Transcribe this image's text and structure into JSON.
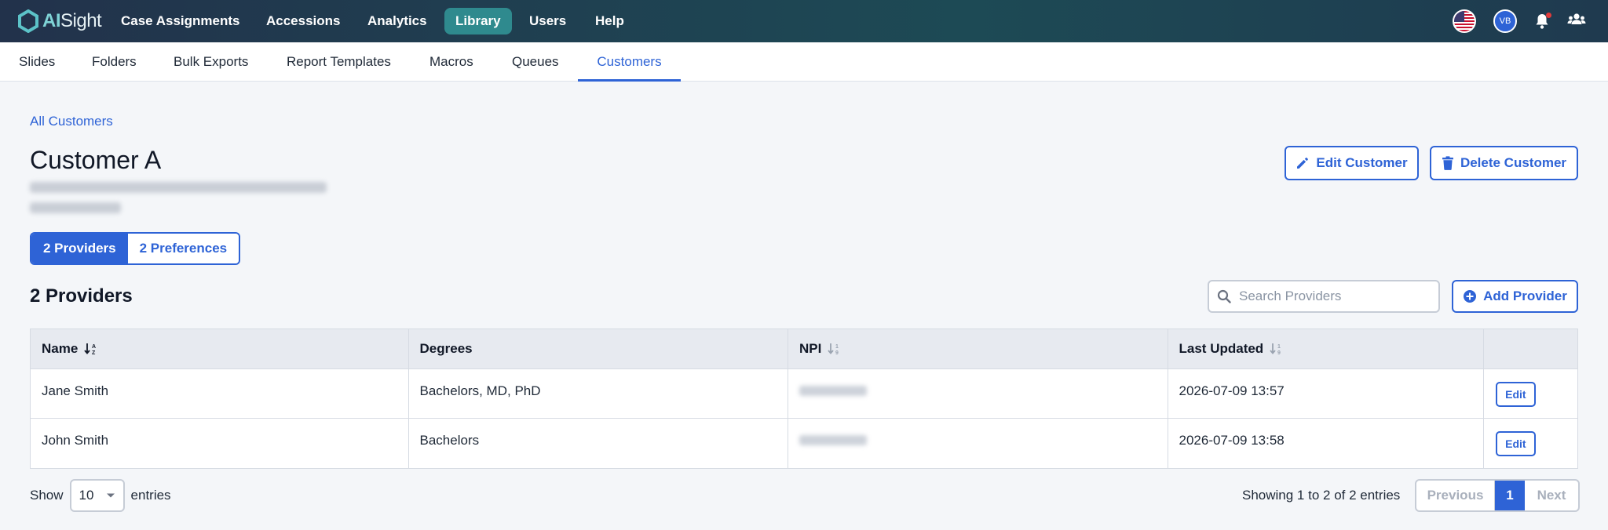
{
  "app": {
    "logo_text_a": "AI",
    "logo_text_b": "Sight"
  },
  "topnav": {
    "items": [
      {
        "label": "Case Assignments"
      },
      {
        "label": "Accessions"
      },
      {
        "label": "Analytics"
      },
      {
        "label": "Library"
      },
      {
        "label": "Users"
      },
      {
        "label": "Help"
      }
    ],
    "active": "Library",
    "avatar_initials": "VB",
    "icons": [
      "us-flag-icon",
      "avatar",
      "bell-icon",
      "users-icon"
    ]
  },
  "subnav": {
    "items": [
      {
        "label": "Slides"
      },
      {
        "label": "Folders"
      },
      {
        "label": "Bulk Exports"
      },
      {
        "label": "Report Templates"
      },
      {
        "label": "Macros"
      },
      {
        "label": "Queues"
      },
      {
        "label": "Customers"
      }
    ],
    "active": "Customers"
  },
  "breadcrumb": "All Customers",
  "customer": {
    "name": "Customer A"
  },
  "actions": {
    "edit": "Edit Customer",
    "delete": "Delete Customer"
  },
  "tabs": {
    "providers": "2 Providers",
    "preferences": "2 Preferences"
  },
  "section_title": "2 Providers",
  "search": {
    "placeholder": "Search Providers",
    "value": ""
  },
  "add_button": "Add Provider",
  "table": {
    "columns": [
      "Name",
      "Degrees",
      "NPI",
      "Last Updated",
      ""
    ],
    "rows": [
      {
        "name": "Jane Smith",
        "degrees": "Bachelors, MD, PhD",
        "last_updated": "2026-07-09 13:57",
        "action": "Edit"
      },
      {
        "name": "John Smith",
        "degrees": "Bachelors",
        "last_updated": "2026-07-09 13:58",
        "action": "Edit"
      }
    ]
  },
  "footer": {
    "show_label": "Show",
    "page_size": "10",
    "entries_label": "entries",
    "showing": "Showing 1 to 2 of 2 entries",
    "prev": "Previous",
    "page": "1",
    "next": "Next"
  },
  "colors": {
    "accent": "#2e63d6",
    "nav_active": "#2f8a8e",
    "nav_bg": "#22324b"
  }
}
